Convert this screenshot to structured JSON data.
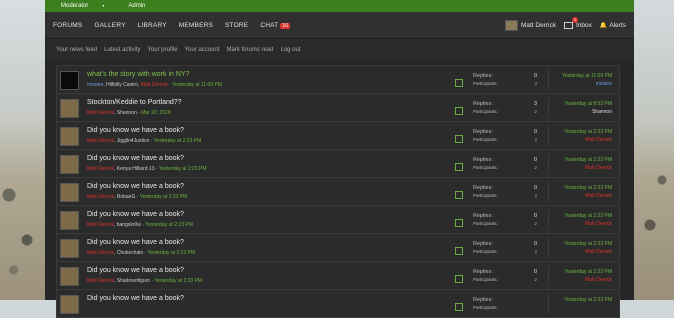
{
  "topbar": {
    "moderator": "Moderator",
    "admin": "Admin"
  },
  "nav": {
    "forums": "FORUMS",
    "gallery": "GALLERY",
    "library": "LIBRARY",
    "members": "MEMBERS",
    "store": "STORE",
    "chat": "CHAT",
    "chat_badge": "16",
    "user": "Matt Derrick",
    "inbox": "Inbox",
    "inbox_badge": "1",
    "alerts": "Alerts"
  },
  "subnav": [
    "Your news feed",
    "Latest activity",
    "Your profile",
    "Your account",
    "Mark forums read",
    "Log out"
  ],
  "threads": [
    {
      "title": "what's the story with work in NY?",
      "title_color": "green",
      "thumb": "dark",
      "meta": [
        {
          "t": "mstaire",
          "c": "blue"
        },
        {
          "t": ", Hillbilly Castro, ",
          "c": "plain"
        },
        {
          "t": "Matt Derrick",
          "c": "red"
        },
        {
          "t": " · Yesterday at 11:09 PM",
          "c": "green"
        }
      ],
      "replies": "0",
      "participants": "3",
      "last_time": "Yesterday at 11:09 PM",
      "last_user": "mstaire",
      "last_user_color": "blue"
    },
    {
      "title": "Stockton/Keddie to Portland??",
      "title_color": "plain",
      "thumb": "photo",
      "meta": [
        {
          "t": "Matt Derrick",
          "c": "red"
        },
        {
          "t": ", Shannon · ",
          "c": "plain"
        },
        {
          "t": "Mar 20, 2018",
          "c": "green"
        }
      ],
      "replies": "3",
      "participants": "2",
      "last_time": "Yesterday at 8:53 PM",
      "last_user": "Shannon",
      "last_user_color": "plain"
    },
    {
      "title": "Did you know we have a book?",
      "title_color": "plain",
      "thumb": "photo",
      "meta": [
        {
          "t": "Matt Derrick",
          "c": "red"
        },
        {
          "t": ", Jigglin4Justice · ",
          "c": "plain"
        },
        {
          "t": "Yesterday at 2:23 PM",
          "c": "green"
        }
      ],
      "replies": "0",
      "participants": "2",
      "last_time": "Yesterday at 2:23 PM",
      "last_user": "Matt Derrick",
      "last_user_color": "red"
    },
    {
      "title": "Did you know we have a book?",
      "title_color": "plain",
      "thumb": "photo",
      "meta": [
        {
          "t": "Matt Derrick",
          "c": "red"
        },
        {
          "t": ", Kenya Hilliard 13 · ",
          "c": "plain"
        },
        {
          "t": "Yesterday at 2:23 PM",
          "c": "green"
        }
      ],
      "replies": "0",
      "participants": "2",
      "last_time": "Yesterday at 2:23 PM",
      "last_user": "Matt Derrick",
      "last_user_color": "red"
    },
    {
      "title": "Did you know we have a book?",
      "title_color": "plain",
      "thumb": "photo",
      "meta": [
        {
          "t": "Matt Derrick",
          "c": "red"
        },
        {
          "t": ", RobaeG · ",
          "c": "plain"
        },
        {
          "t": "Yesterday at 2:23 PM",
          "c": "green"
        }
      ],
      "replies": "0",
      "participants": "2",
      "last_time": "Yesterday at 2:23 PM",
      "last_user": "Matt Derrick",
      "last_user_color": "red"
    },
    {
      "title": "Did you know we have a book?",
      "title_color": "plain",
      "thumb": "photo",
      "meta": [
        {
          "t": "Matt Derrick",
          "c": "red"
        },
        {
          "t": ", bangskr0w · ",
          "c": "plain"
        },
        {
          "t": "Yesterday at 2:23 PM",
          "c": "green"
        }
      ],
      "replies": "0",
      "participants": "2",
      "last_time": "Yesterday at 2:23 PM",
      "last_user": "Matt Derrick",
      "last_user_color": "red"
    },
    {
      "title": "Did you know we have a book?",
      "title_color": "plain",
      "thumb": "photo",
      "meta": [
        {
          "t": "Matt Derrick",
          "c": "red"
        },
        {
          "t": ", Chokechain · ",
          "c": "plain"
        },
        {
          "t": "Yesterday at 2:23 PM",
          "c": "green"
        }
      ],
      "replies": "0",
      "participants": "2",
      "last_time": "Yesterday at 2:23 PM",
      "last_user": "Matt Derrick",
      "last_user_color": "red"
    },
    {
      "title": "Did you know we have a book?",
      "title_color": "plain",
      "thumb": "photo",
      "meta": [
        {
          "t": "Matt Derrick",
          "c": "red"
        },
        {
          "t": ", Shadowofiguro · ",
          "c": "plain"
        },
        {
          "t": "Yesterday at 2:23 PM",
          "c": "green"
        }
      ],
      "replies": "0",
      "participants": "2",
      "last_time": "Yesterday at 2:23 PM",
      "last_user": "Matt Derrick",
      "last_user_color": "red"
    },
    {
      "title": "Did you know we have a book?",
      "title_color": "plain",
      "thumb": "photo",
      "meta": [],
      "replies": "",
      "participants": "",
      "last_time": "Yesterday at 2:23 PM",
      "last_user": "",
      "last_user_color": "red"
    }
  ],
  "labels": {
    "replies": "Replies:",
    "participants": "Participants:"
  }
}
